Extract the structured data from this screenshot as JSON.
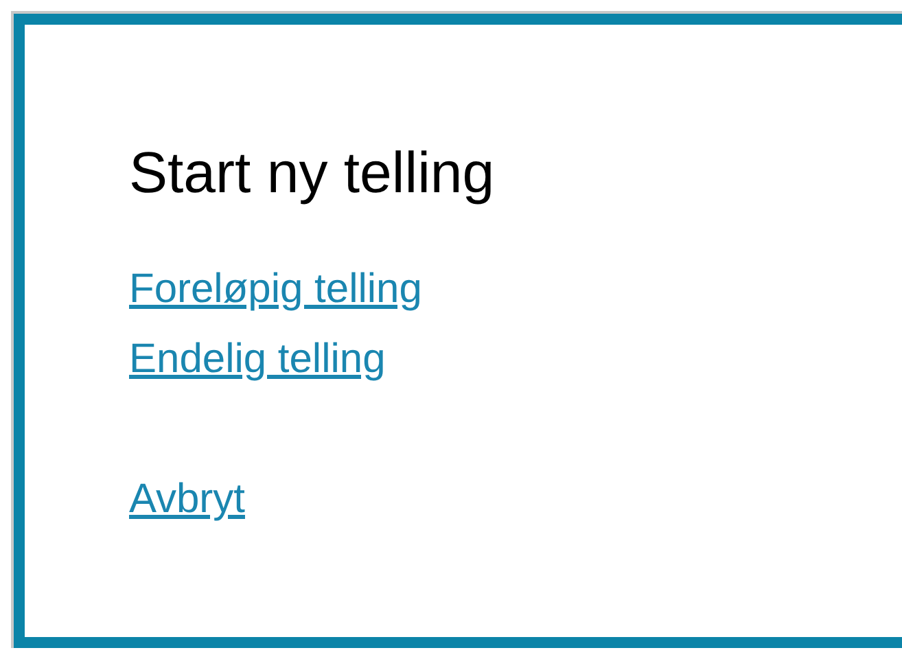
{
  "dialog": {
    "title": "Start ny telling",
    "links": [
      {
        "label": "Foreløpig telling"
      },
      {
        "label": "Endelig telling"
      }
    ],
    "cancel": "Avbryt"
  }
}
